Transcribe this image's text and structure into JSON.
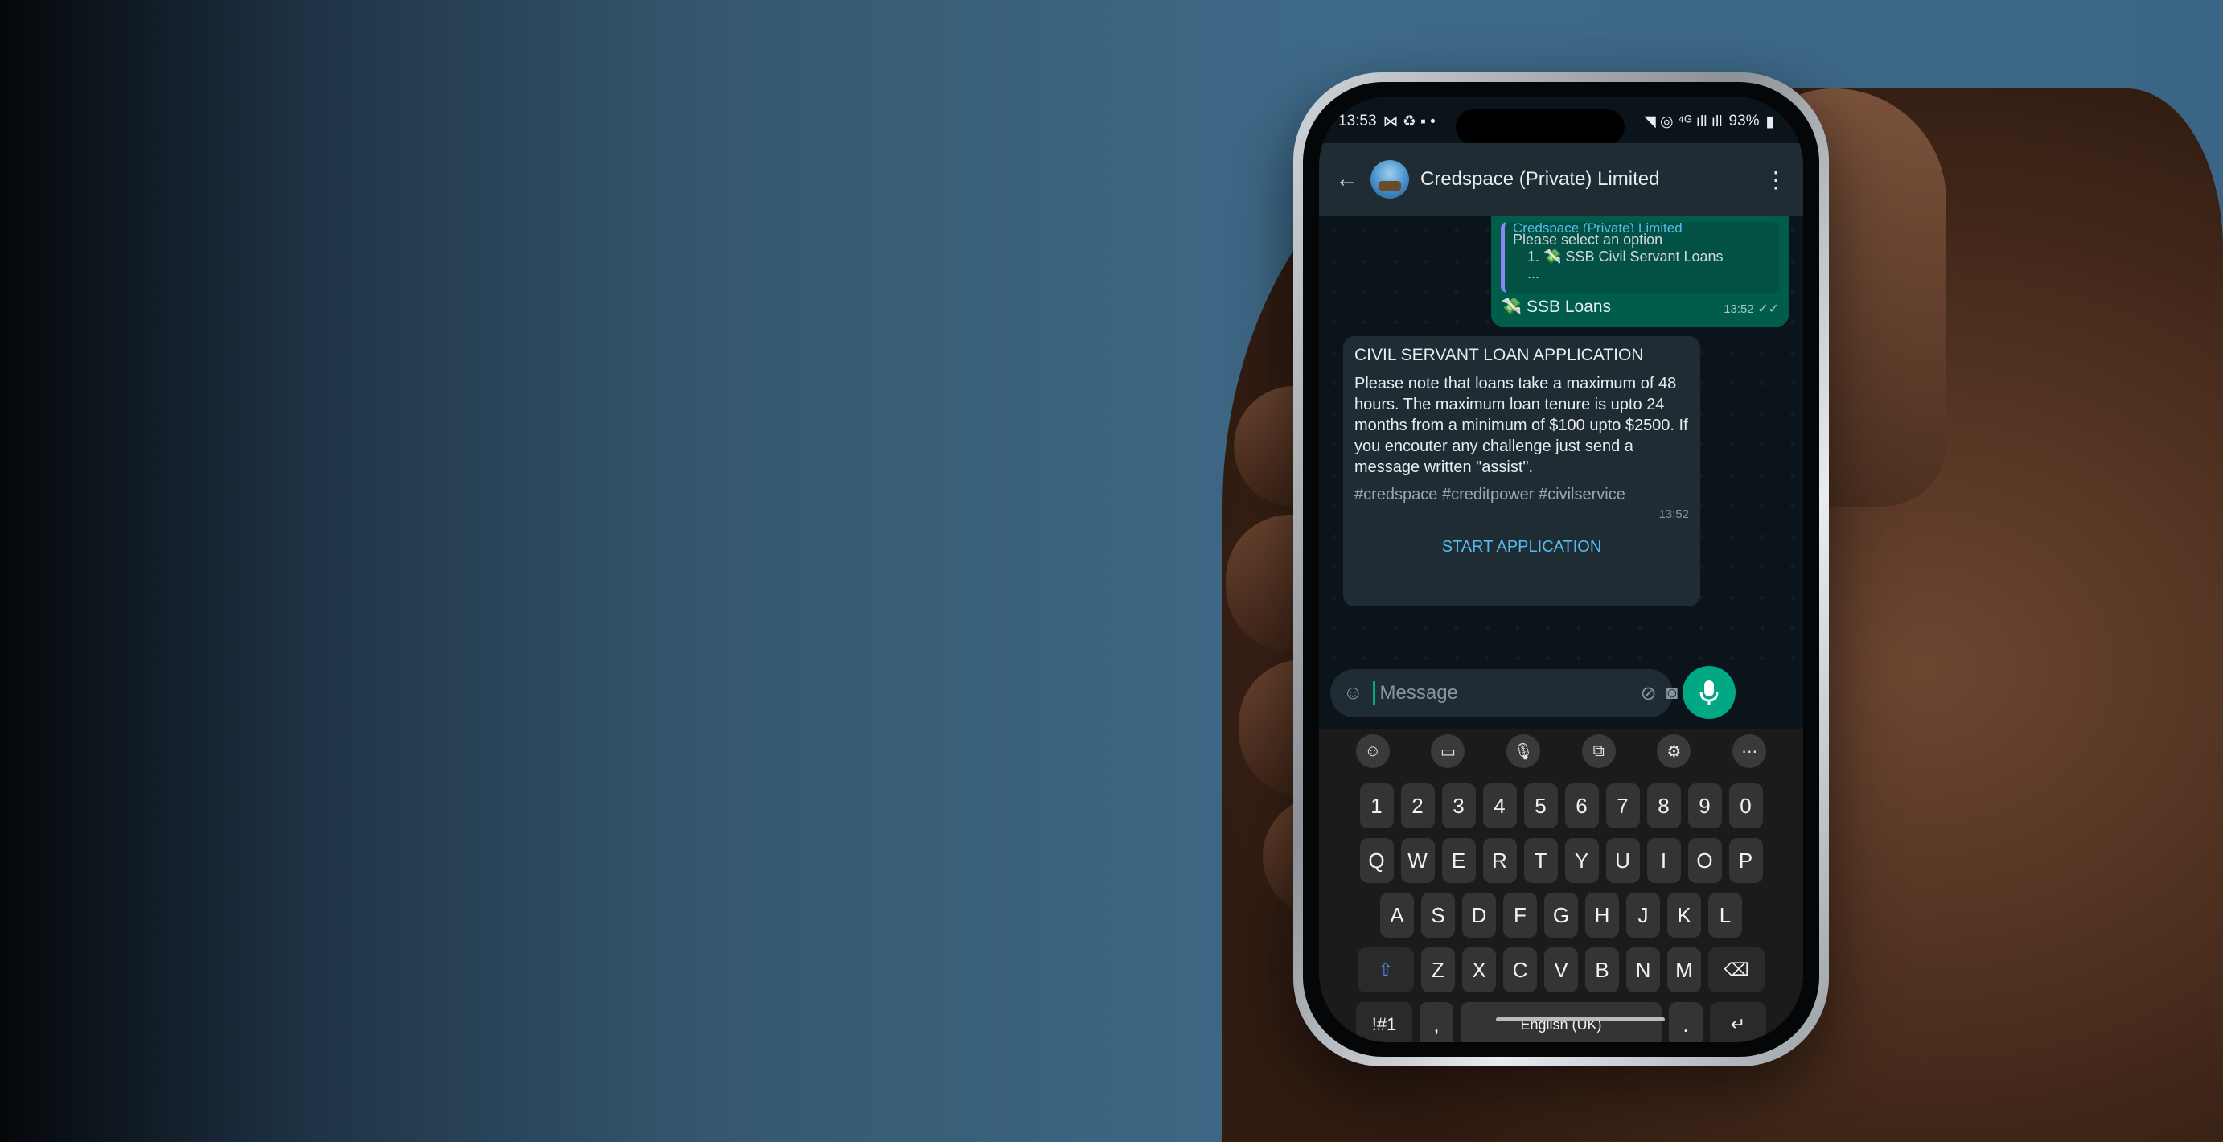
{
  "status_bar": {
    "time": "13:53",
    "left_icons": "⋈ ♻ ▪ •",
    "right_icons": "◥ ◎ ⁴ᴳ ıll ıll",
    "battery": "93%"
  },
  "chat": {
    "title": "Credspace (Private) Limited",
    "quoted": {
      "author": "Credspace (Private) Limited",
      "line1": "Please select an option",
      "item1": "1. 💸 SSB Civil Servant Loans",
      "ellipsis": "..."
    },
    "outgoing": {
      "text": "💸 SSB Loans",
      "time": "13:52"
    },
    "incoming": {
      "title": "CIVIL SERVANT LOAN APPLICATION",
      "body": "Please note that loans take a maximum of 48 hours. The maximum loan tenure is upto 24 months from  a minimum of $100 upto $2500. If you encouter any challenge just send a message written \"assist\".",
      "tags": "#credspace #creditpower #civilservice",
      "time": "13:52",
      "cta": "START APPLICATION"
    }
  },
  "composer": {
    "placeholder": "Message"
  },
  "keyboard": {
    "number_row": [
      "1",
      "2",
      "3",
      "4",
      "5",
      "6",
      "7",
      "8",
      "9",
      "0"
    ],
    "row1": [
      "Q",
      "W",
      "E",
      "R",
      "T",
      "Y",
      "U",
      "I",
      "O",
      "P"
    ],
    "row2": [
      "A",
      "S",
      "D",
      "F",
      "G",
      "H",
      "J",
      "K",
      "L"
    ],
    "row3": [
      "Z",
      "X",
      "C",
      "V",
      "B",
      "N",
      "M"
    ],
    "symbols_key": "!#1",
    "comma_key": ",",
    "space_label": "English (UK)",
    "period_key": "."
  },
  "colors": {
    "accent": "#00a884",
    "outgoing_bubble": "#005c4b",
    "incoming_bubble": "#1f2c34",
    "link": "#53bdeb"
  }
}
